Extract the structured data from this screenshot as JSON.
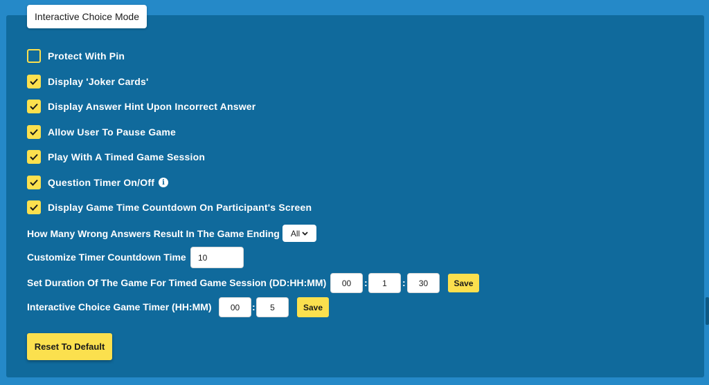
{
  "tab": {
    "label": "Interactive Choice Mode"
  },
  "options": [
    {
      "label": "Protect With Pin",
      "checked": false
    },
    {
      "label": "Display 'Joker Cards'",
      "checked": true
    },
    {
      "label": "Display Answer Hint Upon Incorrect Answer",
      "checked": true
    },
    {
      "label": "Allow User To Pause Game",
      "checked": true
    },
    {
      "label": "Play With A Timed Game Session",
      "checked": true
    },
    {
      "label": "Question Timer On/Off",
      "checked": true,
      "info_icon": "info-icon"
    },
    {
      "label": "Display Game Time Countdown On Participant's Screen",
      "checked": true
    }
  ],
  "wrong_answers": {
    "label": "How Many Wrong Answers Result In The Game Ending",
    "selected": "All"
  },
  "timer_countdown": {
    "label": "Customize Timer Countdown Time",
    "value": "10"
  },
  "game_duration": {
    "label": "Set Duration Of The Game For Timed Game Session (DD:HH:MM)",
    "dd": "00",
    "hh": "1",
    "mm": "30",
    "separator": ":",
    "save_label": "Save"
  },
  "game_timer": {
    "label": "Interactive Choice Game Timer (HH:MM)",
    "hh": "00",
    "mm": "5",
    "separator": ":",
    "save_label": "Save"
  },
  "reset": {
    "label": "Reset To Default"
  },
  "info_glyph": "i",
  "colors": {
    "background": "#2589c8",
    "panel": "#106a9c",
    "accent": "#fbe04e",
    "text": "#ffffff"
  }
}
